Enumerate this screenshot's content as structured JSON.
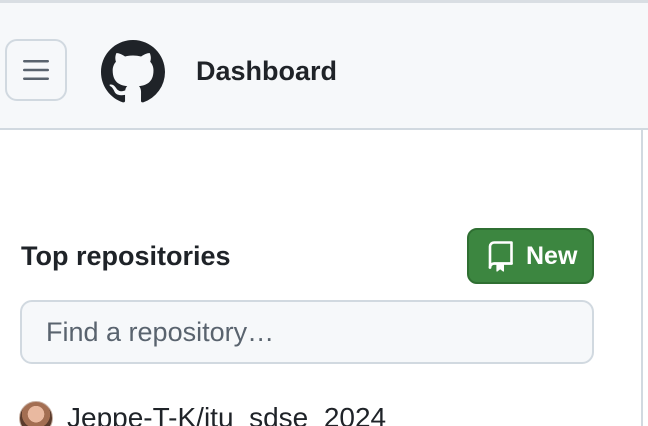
{
  "header": {
    "title": "Dashboard",
    "menu_icon": "hamburger-icon",
    "logo_icon": "github-logo-icon"
  },
  "repos": {
    "title": "Top repositories",
    "new_button": {
      "label": "New",
      "icon": "repo-icon",
      "color": "#3c8640"
    },
    "search": {
      "placeholder": "Find a repository…",
      "value": ""
    },
    "items": [
      {
        "name": "Jeppe-T-K/itu_sdse_2024"
      }
    ]
  }
}
